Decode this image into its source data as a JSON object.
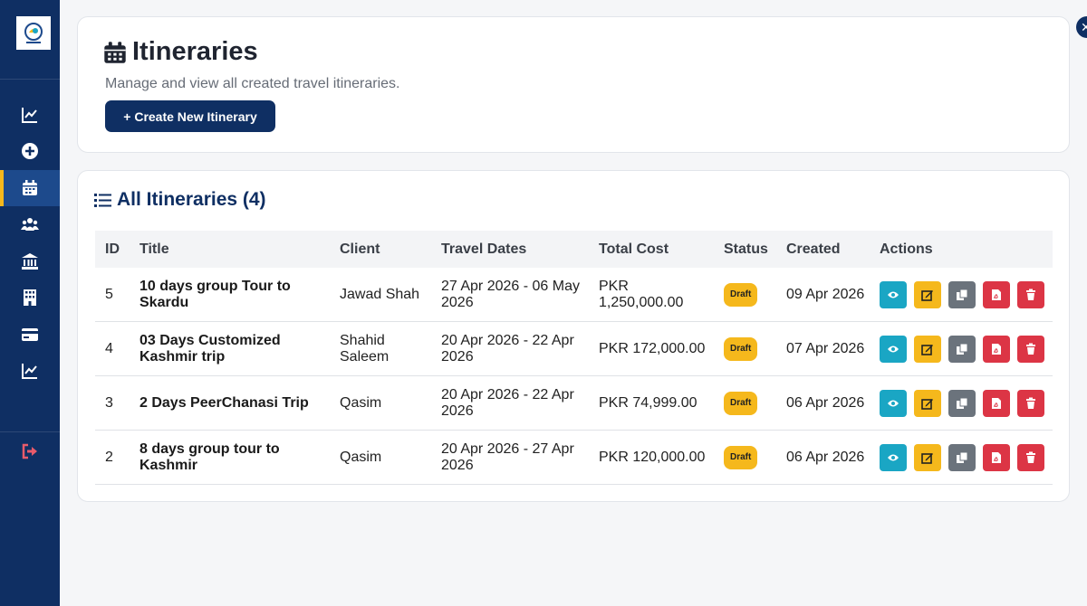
{
  "header": {
    "title": "Itineraries",
    "subtitle": "Manage and view all created travel itineraries.",
    "create_button": "+ Create New Itinerary"
  },
  "sidebar": {
    "items": [
      {
        "icon": "chart-line-icon",
        "active": false
      },
      {
        "icon": "plus-circle-icon",
        "active": false
      },
      {
        "icon": "calendar-icon",
        "active": true
      },
      {
        "icon": "users-icon",
        "active": false
      },
      {
        "icon": "bank-icon",
        "active": false
      },
      {
        "icon": "building-icon",
        "active": false
      },
      {
        "icon": "credit-card-icon",
        "active": false
      },
      {
        "icon": "chart-line-icon",
        "active": false
      }
    ],
    "logout_icon": "sign-out-icon"
  },
  "table": {
    "title": "All Itineraries (4)",
    "columns": [
      "ID",
      "Title",
      "Client",
      "Travel Dates",
      "Total Cost",
      "Status",
      "Created",
      "Actions"
    ],
    "rows": [
      {
        "id": "5",
        "title": "10 days group Tour to Skardu",
        "client": "Jawad Shah",
        "dates": "27 Apr 2026 - 06 May 2026",
        "cost": "PKR 1,250,000.00",
        "status": "Draft",
        "created": "09 Apr 2026"
      },
      {
        "id": "4",
        "title": "03 Days Customized Kashmir trip",
        "client": "Shahid Saleem",
        "dates": "20 Apr 2026 - 22 Apr 2026",
        "cost": "PKR 172,000.00",
        "status": "Draft",
        "created": "07 Apr 2026"
      },
      {
        "id": "3",
        "title": "2 Days PeerChanasi Trip",
        "client": "Qasim",
        "dates": "20 Apr 2026 - 22 Apr 2026",
        "cost": "PKR 74,999.00",
        "status": "Draft",
        "created": "06 Apr 2026"
      },
      {
        "id": "2",
        "title": "8 days group tour to Kashmir",
        "client": "Qasim",
        "dates": "20 Apr 2026 - 27 Apr 2026",
        "cost": "PKR 120,000.00",
        "status": "Draft",
        "created": "06 Apr 2026"
      }
    ]
  },
  "colors": {
    "sidebar": "#0f2f63",
    "accent": "#f5b81c",
    "view": "#1aa6c4",
    "duplicate": "#6b737c",
    "danger": "#dc3545"
  }
}
